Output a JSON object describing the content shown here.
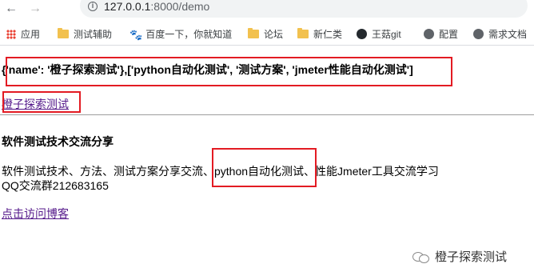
{
  "browser": {
    "url_host": "127.0.0.1",
    "url_path": ":8000/demo"
  },
  "bookmarks": [
    {
      "label": "应用",
      "icon": "apps-grid-icon"
    },
    {
      "label": "测试辅助",
      "icon": "folder-icon"
    },
    {
      "label": "百度一下，你就知道",
      "icon": "baidu-paw-icon"
    },
    {
      "label": "论坛",
      "icon": "folder-icon"
    },
    {
      "label": "新仁类",
      "icon": "folder-icon"
    },
    {
      "label": "王菇git",
      "icon": "github-icon"
    },
    {
      "label": "配置",
      "icon": "globe-icon"
    },
    {
      "label": "需求文档",
      "icon": "globe-icon"
    }
  ],
  "page": {
    "dict_line": "{'name': '橙子探索测试'},['python自动化测试', '测试方案', 'jmeter性能自动化测试']",
    "link_title": "橙子探索测试",
    "heading": "软件测试技术交流分享",
    "desc_part1": "软件测试技术、方法、测试方案分享交流、",
    "desc_highlight": "python自动化测试",
    "desc_part2": "、性能Jmeter工具交流学习",
    "desc_line2": "QQ交流群212683165",
    "link_blog": "点击访问博客"
  },
  "watermark": {
    "text": "橙子探索测试"
  },
  "colors": {
    "highlight_box": "#e31b23",
    "visited_link": "#551a8b"
  }
}
